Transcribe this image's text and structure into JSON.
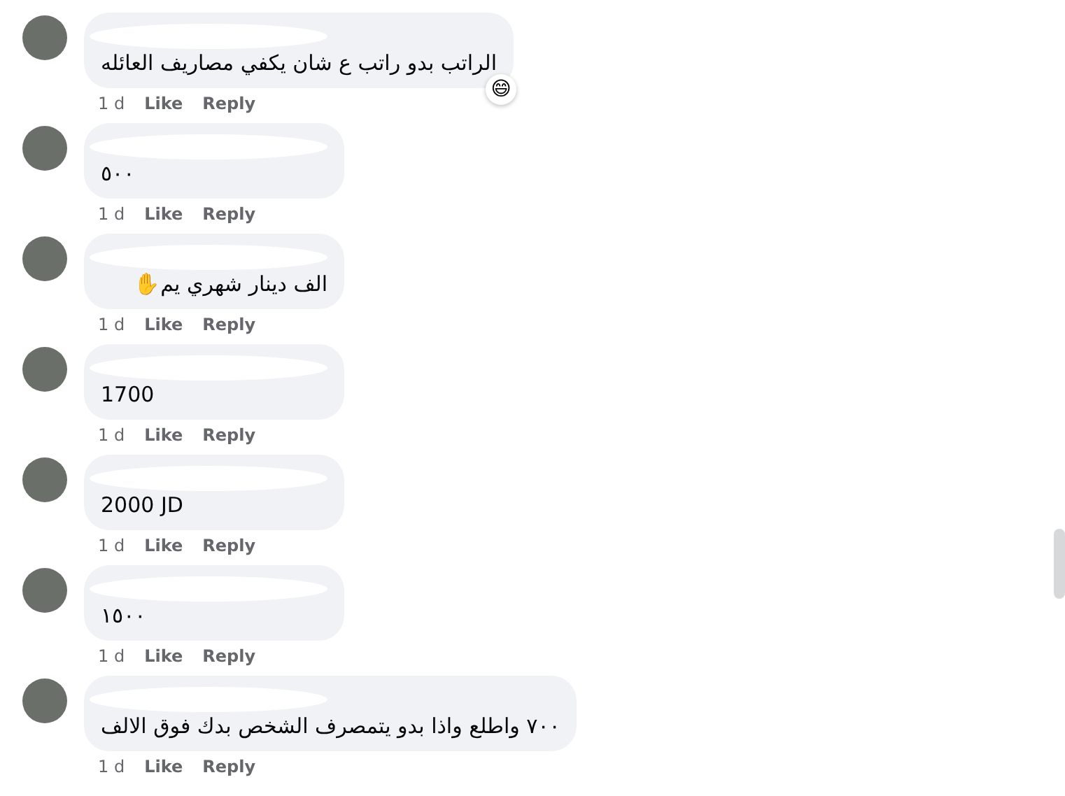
{
  "comments": [
    {
      "text": "الراتب بدو راتب ع شان يكفي مصاريف العائله",
      "reaction": "😄",
      "time": "1 d",
      "like": "Like",
      "reply": "Reply"
    },
    {
      "text": "٥٠٠",
      "time": "1 d",
      "like": "Like",
      "reply": "Reply"
    },
    {
      "text": "الف دينار شهري يم✋",
      "time": "1 d",
      "like": "Like",
      "reply": "Reply"
    },
    {
      "text": "1700",
      "time": "1 d",
      "like": "Like",
      "reply": "Reply"
    },
    {
      "text": "2000 JD",
      "time": "1 d",
      "like": "Like",
      "reply": "Reply"
    },
    {
      "text": "١٥٠٠",
      "time": "1 d",
      "like": "Like",
      "reply": "Reply"
    },
    {
      "text": "٧٠٠ واطلع واذا بدو يتمصرف الشخص بدك فوق الالف",
      "time": "1 d",
      "like": "Like",
      "reply": "Reply"
    }
  ]
}
